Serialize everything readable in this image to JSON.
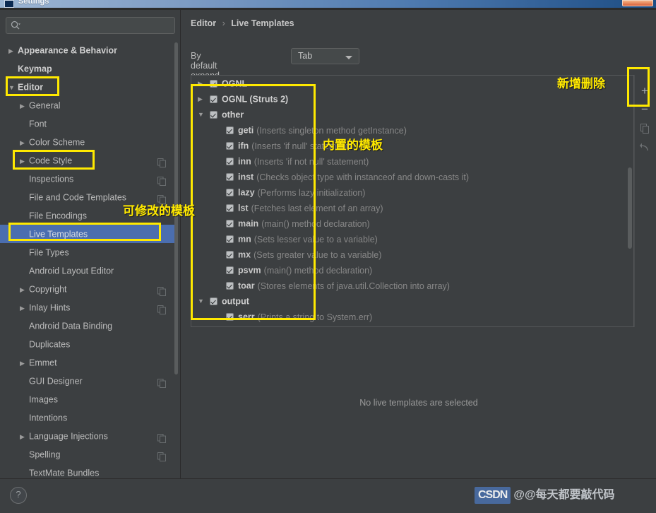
{
  "window": {
    "title": "Settings",
    "close_label": ""
  },
  "sidebar": {
    "search": {
      "placeholder": "",
      "value": "",
      "icon": "search-icon"
    },
    "items": [
      {
        "label": "Appearance & Behavior",
        "arrow": "▶",
        "indent": 1,
        "bold": true,
        "selected": false,
        "copy": false
      },
      {
        "label": "Keymap",
        "arrow": "",
        "indent": 1,
        "bold": true,
        "selected": false,
        "copy": false
      },
      {
        "label": "Editor",
        "arrow": "▼",
        "indent": 1,
        "bold": true,
        "selected": false,
        "copy": false
      },
      {
        "label": "General",
        "arrow": "▶",
        "indent": 2,
        "bold": false,
        "selected": false,
        "copy": false
      },
      {
        "label": "Font",
        "arrow": "",
        "indent": 2,
        "bold": false,
        "selected": false,
        "copy": false
      },
      {
        "label": "Color Scheme",
        "arrow": "▶",
        "indent": 2,
        "bold": false,
        "selected": false,
        "copy": false
      },
      {
        "label": "Code Style",
        "arrow": "▶",
        "indent": 2,
        "bold": false,
        "selected": false,
        "copy": true
      },
      {
        "label": "Inspections",
        "arrow": "",
        "indent": 2,
        "bold": false,
        "selected": false,
        "copy": true
      },
      {
        "label": "File and Code Templates",
        "arrow": "",
        "indent": 2,
        "bold": false,
        "selected": false,
        "copy": true
      },
      {
        "label": "File Encodings",
        "arrow": "",
        "indent": 2,
        "bold": false,
        "selected": false,
        "copy": false
      },
      {
        "label": "Live Templates",
        "arrow": "",
        "indent": 2,
        "bold": false,
        "selected": true,
        "copy": false
      },
      {
        "label": "File Types",
        "arrow": "",
        "indent": 2,
        "bold": false,
        "selected": false,
        "copy": false
      },
      {
        "label": "Android Layout Editor",
        "arrow": "",
        "indent": 2,
        "bold": false,
        "selected": false,
        "copy": false
      },
      {
        "label": "Copyright",
        "arrow": "▶",
        "indent": 2,
        "bold": false,
        "selected": false,
        "copy": true
      },
      {
        "label": "Inlay Hints",
        "arrow": "▶",
        "indent": 2,
        "bold": false,
        "selected": false,
        "copy": true
      },
      {
        "label": "Android Data Binding",
        "arrow": "",
        "indent": 2,
        "bold": false,
        "selected": false,
        "copy": false
      },
      {
        "label": "Duplicates",
        "arrow": "",
        "indent": 2,
        "bold": false,
        "selected": false,
        "copy": false
      },
      {
        "label": "Emmet",
        "arrow": "▶",
        "indent": 2,
        "bold": false,
        "selected": false,
        "copy": false
      },
      {
        "label": "GUI Designer",
        "arrow": "",
        "indent": 2,
        "bold": false,
        "selected": false,
        "copy": true
      },
      {
        "label": "Images",
        "arrow": "",
        "indent": 2,
        "bold": false,
        "selected": false,
        "copy": false
      },
      {
        "label": "Intentions",
        "arrow": "",
        "indent": 2,
        "bold": false,
        "selected": false,
        "copy": false
      },
      {
        "label": "Language Injections",
        "arrow": "▶",
        "indent": 2,
        "bold": false,
        "selected": false,
        "copy": true
      },
      {
        "label": "Spelling",
        "arrow": "",
        "indent": 2,
        "bold": false,
        "selected": false,
        "copy": true
      },
      {
        "label": "TextMate Bundles",
        "arrow": "",
        "indent": 2,
        "bold": false,
        "selected": false,
        "copy": false
      }
    ]
  },
  "content": {
    "breadcrumb": {
      "parent": "Editor",
      "separator": "›",
      "current": "Live Templates"
    },
    "expand_with": {
      "label": "By default expand with",
      "value": "Tab"
    },
    "empty_detail": "No live templates are selected",
    "templates": [
      {
        "type": "group",
        "arrow": "▶",
        "checked": true,
        "name": "OGNL"
      },
      {
        "type": "group",
        "arrow": "▶",
        "checked": true,
        "name": "OGNL (Struts 2)"
      },
      {
        "type": "group",
        "arrow": "▼",
        "checked": true,
        "name": "other"
      },
      {
        "type": "leaf",
        "checked": true,
        "abbr": "geti",
        "desc": "(Inserts singleton method getInstance)"
      },
      {
        "type": "leaf",
        "checked": true,
        "abbr": "ifn",
        "desc": "(Inserts 'if null' statement)"
      },
      {
        "type": "leaf",
        "checked": true,
        "abbr": "inn",
        "desc": "(Inserts 'if not null' statement)"
      },
      {
        "type": "leaf",
        "checked": true,
        "abbr": "inst",
        "desc": "(Checks object type with instanceof and down-casts it)"
      },
      {
        "type": "leaf",
        "checked": true,
        "abbr": "lazy",
        "desc": "(Performs lazy initialization)"
      },
      {
        "type": "leaf",
        "checked": true,
        "abbr": "lst",
        "desc": "(Fetches last element of an array)"
      },
      {
        "type": "leaf",
        "checked": true,
        "abbr": "main",
        "desc": "(main() method declaration)"
      },
      {
        "type": "leaf",
        "checked": true,
        "abbr": "mn",
        "desc": "(Sets lesser value to a variable)"
      },
      {
        "type": "leaf",
        "checked": true,
        "abbr": "mx",
        "desc": "(Sets greater value to a variable)"
      },
      {
        "type": "leaf",
        "checked": true,
        "abbr": "psvm",
        "desc": "(main() method declaration)"
      },
      {
        "type": "leaf",
        "checked": true,
        "abbr": "toar",
        "desc": "(Stores elements of java.util.Collection into array)"
      },
      {
        "type": "group",
        "arrow": "▼",
        "checked": true,
        "name": "output"
      },
      {
        "type": "leaf",
        "checked": true,
        "abbr": "serr",
        "desc": "(Prints a string to System.err)"
      }
    ],
    "toolbar": [
      {
        "icon": "plus-icon",
        "glyph": "+"
      },
      {
        "icon": "minus-icon",
        "glyph": "−"
      },
      {
        "icon": "copy-icon",
        "glyph": ""
      },
      {
        "icon": "revert-icon",
        "glyph": ""
      }
    ]
  },
  "bottom": {
    "help_label": "?"
  },
  "watermark": {
    "badge": "CSDN",
    "text": "@@每天都要敲代码"
  },
  "annotations": [
    {
      "name": "annotation-editable-templates",
      "text": "可修改的模板"
    },
    {
      "name": "annotation-builtin-templates",
      "text": "内置的模板"
    },
    {
      "name": "annotation-add-delete",
      "text": "新增删除"
    }
  ],
  "colors": {
    "highlight": "#ffe900",
    "selection": "#4b6eaf",
    "panel_bg": "#3c3f41"
  }
}
